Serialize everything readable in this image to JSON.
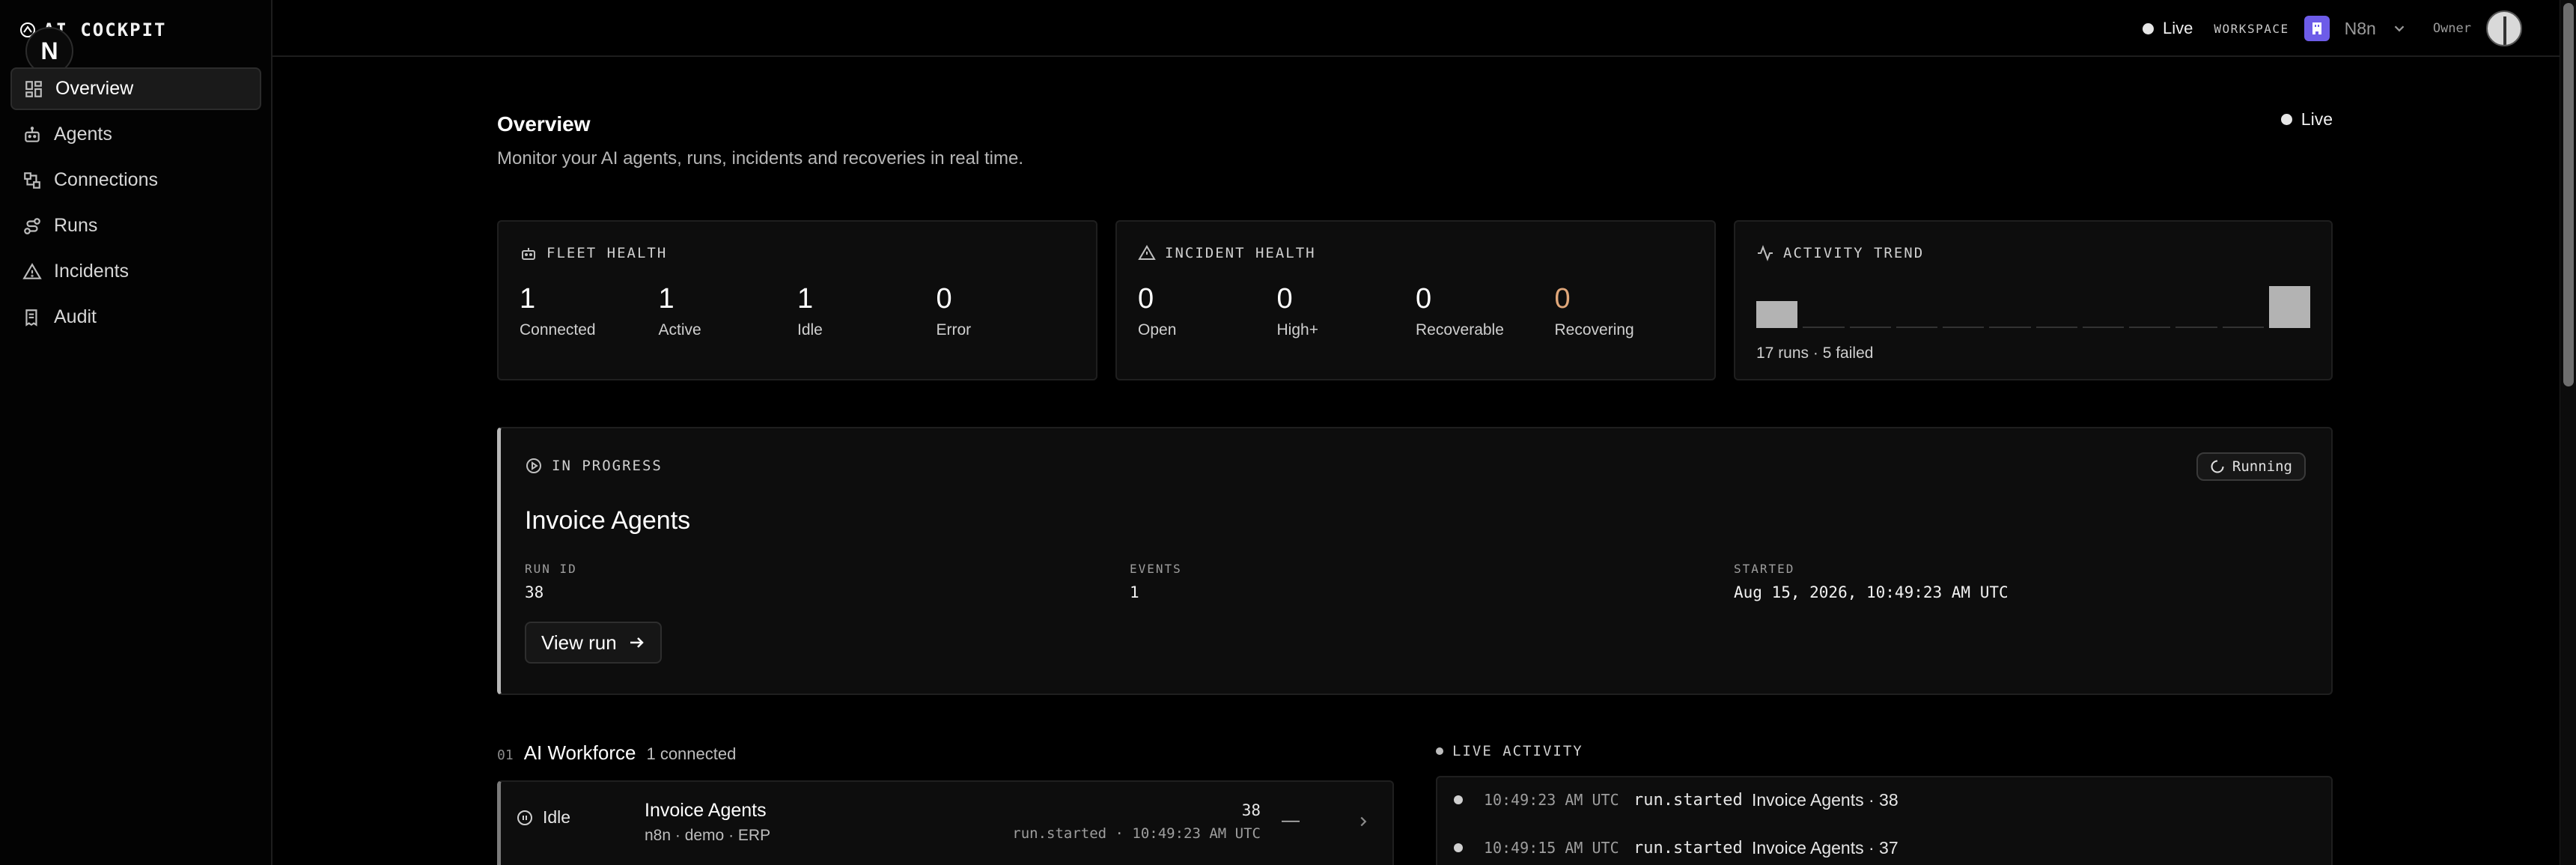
{
  "app": {
    "title": "AI COCKPIT",
    "logo_letter": "N"
  },
  "sidebar": {
    "items": [
      {
        "label": "Overview",
        "icon": "dashboard-icon",
        "active": true
      },
      {
        "label": "Agents",
        "icon": "robot-icon"
      },
      {
        "label": "Connections",
        "icon": "connections-icon"
      },
      {
        "label": "Runs",
        "icon": "route-icon"
      },
      {
        "label": "Incidents",
        "icon": "warning-icon"
      },
      {
        "label": "Audit",
        "icon": "receipt-icon"
      }
    ]
  },
  "topbar": {
    "live_label": "Live",
    "workspace_label": "WORKSPACE",
    "workspace_name": "N8n",
    "role": "Owner"
  },
  "page": {
    "title": "Overview",
    "subtitle": "Monitor your AI agents, runs, incidents and recoveries in real time.",
    "live_label": "Live"
  },
  "fleet_health": {
    "title": "FLEET HEALTH",
    "stats": [
      {
        "value": "1",
        "label": "Connected"
      },
      {
        "value": "1",
        "label": "Active"
      },
      {
        "value": "1",
        "label": "Idle"
      },
      {
        "value": "0",
        "label": "Error"
      }
    ]
  },
  "incident_health": {
    "title": "INCIDENT HEALTH",
    "stats": [
      {
        "value": "0",
        "label": "Open"
      },
      {
        "value": "0",
        "label": "High+"
      },
      {
        "value": "0",
        "label": "Recoverable"
      },
      {
        "value": "0",
        "label": "Recovering"
      }
    ]
  },
  "activity_trend": {
    "title": "ACTIVITY TREND",
    "caption": "17 runs · 5 failed",
    "bars": [
      0.65,
      0,
      0,
      0,
      0,
      0,
      0,
      0,
      0,
      0,
      0,
      1.0
    ]
  },
  "in_progress": {
    "header": "IN PROGRESS",
    "status": "Running",
    "title": "Invoice Agents",
    "run_id_label": "RUN ID",
    "run_id": "38",
    "events_label": "EVENTS",
    "events": "1",
    "started_label": "STARTED",
    "started": "Aug 15, 2026, 10:49:23 AM UTC",
    "view_button": "View run"
  },
  "workforce": {
    "index": "01",
    "title": "AI Workforce",
    "count": "1 connected",
    "rows": [
      {
        "state": "Idle",
        "name": "Invoice Agents",
        "sub": "n8n · demo · ERP",
        "number": "38",
        "event": "run.started · 10:49:23 AM UTC",
        "dash": "—"
      }
    ]
  },
  "live_activity": {
    "title": "LIVE ACTIVITY",
    "rows": [
      {
        "time": "10:49:23 AM UTC",
        "type": "run.started",
        "message": "Invoice Agents · 38"
      },
      {
        "time": "10:49:15 AM UTC",
        "type": "run.started",
        "message": "Invoice Agents · 37"
      }
    ]
  }
}
